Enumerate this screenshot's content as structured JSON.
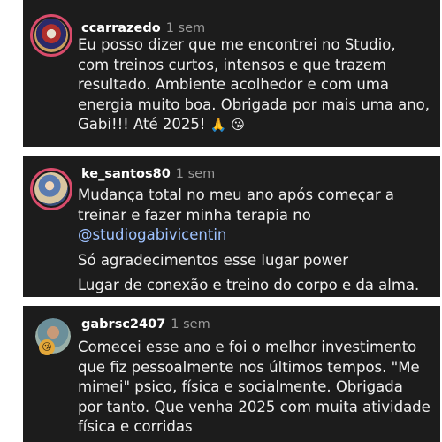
{
  "comments": [
    {
      "username": "ccarrazedo",
      "time": "1 sem",
      "text": "Eu posso dizer que me encontrei no Studio, com treinos curtos, intensos e que trazem resultado. Ambiente acolhedor e com uma energia muito boa. Obrigada por mais uma ano, Gabi!!! Até 2025!",
      "emojis": "🙏 😘"
    },
    {
      "username": "ke_santos80",
      "time": "1 sem",
      "text": "Mudança total no meu ano após começar a treinar e fazer minha terapia no",
      "mention": "@studiogabivicentin",
      "text2": "Só agradecimentos esse lugar power",
      "text3": "Lugar de conexão e treino do corpo e da alma."
    },
    {
      "username": "gabrsc2407",
      "time": "1 sem",
      "text": "Comecei esse ano e foi o melhor investimento que fiz pessoalmente nos últimos tempos. \"Me mimei\" psico, física e socialmente. Obrigada por tanto. Que venha 2025 com muita atividade física e corridas",
      "badge": "😘"
    }
  ]
}
